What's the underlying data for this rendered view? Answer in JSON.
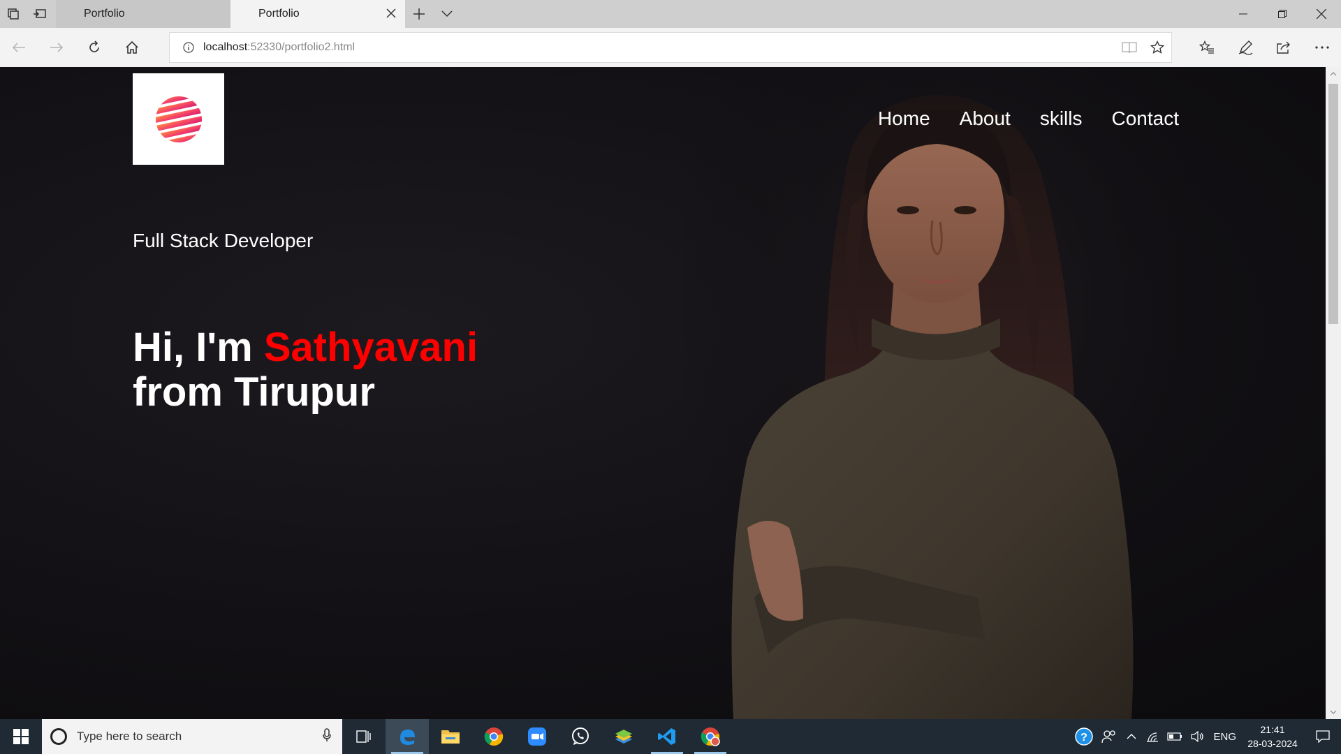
{
  "browser": {
    "tabs": [
      {
        "title": "Portfolio",
        "active": false
      },
      {
        "title": "Portfolio",
        "active": true
      }
    ],
    "url_host": "localhost",
    "url_rest": ":52330/portfolio2.html",
    "icons": {
      "tab_actions": [
        "tab-manager-icon",
        "set-aside-icon"
      ],
      "tab_controls": [
        "close-icon",
        "plus-icon",
        "chevron-down-icon"
      ],
      "nav": [
        "back-icon",
        "forward-icon",
        "refresh-icon",
        "home-icon"
      ],
      "address": [
        "info-icon",
        "reading-view-icon",
        "star-icon"
      ],
      "toolbar": [
        "favorites-icon",
        "pen-icon",
        "share-icon",
        "more-icon"
      ],
      "window": [
        "minimize-icon",
        "restore-icon",
        "window-close-icon"
      ]
    }
  },
  "page": {
    "nav": {
      "home": "Home",
      "about": "About",
      "skills": "skills",
      "contact": "Contact"
    },
    "subtitle": "Full Stack Developer",
    "headline_prefix": "Hi, I'm ",
    "headline_name": "Sathyavani",
    "headline_suffix": "from Tirupur",
    "colors": {
      "background": "#121014",
      "text": "#ffffff",
      "name_accent": "#ff0000"
    }
  },
  "taskbar": {
    "search_placeholder": "Type here to search",
    "apps": [
      "task-view-icon",
      "edge-icon",
      "file-explorer-icon",
      "chrome-icon",
      "zoom-icon",
      "whatsapp-icon",
      "bluestacks-icon",
      "vscode-icon",
      "chrome-profile-icon"
    ],
    "tray": {
      "language": "ENG",
      "time": "21:41",
      "date": "28-03-2024"
    }
  }
}
